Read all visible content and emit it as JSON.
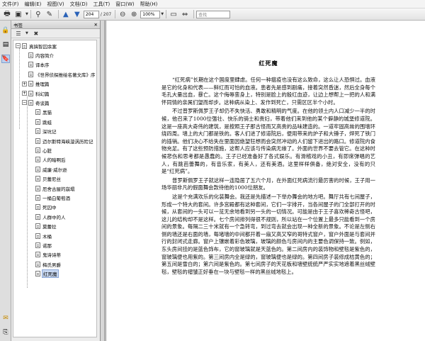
{
  "menubar": [
    "文件(F)",
    "编辑(E)",
    "视图(V)",
    "文档(D)",
    "工具(T)",
    "窗口(W)",
    "帮助(H)"
  ],
  "toolbar": {
    "page_current": "204",
    "page_total": "/ 207",
    "zoom": "100%",
    "search_placeholder": "查找"
  },
  "bookmarks_panel": {
    "title": "书签",
    "options_label": "选项",
    "items": [
      {
        "label": "真搞智囚余案",
        "level": 0,
        "expander": "minus"
      },
      {
        "label": "内容简介",
        "level": 1
      },
      {
        "label": "译本序",
        "level": 1
      },
      {
        "label": "《世界侦探推绘名著文库》序",
        "level": 1
      },
      {
        "label": "推理篇",
        "level": 1,
        "expander": "plus"
      },
      {
        "label": "科幻篇",
        "level": 1,
        "expander": "plus"
      },
      {
        "label": "奇谈篇",
        "level": 1,
        "expander": "minus"
      },
      {
        "label": "黑猫",
        "level": 2
      },
      {
        "label": "跳蛙",
        "level": 2
      },
      {
        "label": "深坑记",
        "level": 2
      },
      {
        "label": "迈尔斯特海峡漩涡历险记",
        "level": 2
      },
      {
        "label": "心脏",
        "level": 2
      },
      {
        "label": "人的暗啊后",
        "level": 2
      },
      {
        "label": "威廉·威尔逊",
        "level": 2
      },
      {
        "label": "贝蕾尼丝",
        "level": 2
      },
      {
        "label": "厄舍古屋的崩塌",
        "level": 2
      },
      {
        "label": "一桶白葡萄酒",
        "level": 2
      },
      {
        "label": "死囚中",
        "level": 2
      },
      {
        "label": "人群中的人",
        "level": 2
      },
      {
        "label": "莫蕾拉",
        "level": 2
      },
      {
        "label": "木桶",
        "level": 2
      },
      {
        "label": "诺那",
        "level": 2
      },
      {
        "label": "鬼诗诗蒂",
        "level": 2
      },
      {
        "label": "梅氏男爵",
        "level": 2
      },
      {
        "label": "红死魔",
        "level": 2,
        "selected": true
      }
    ]
  },
  "document": {
    "title": "红死魔",
    "paragraphs": [
      "“红死病”长期在这个国度里肆虐。任何一种瘟疫也没有这么致命，这么让人恐惧过。血液是它的化身和代表——鲜红而可怕的血液。患者先是感到剧痛，接着突然昏迷，然后全身每个毛孔大量出血，暴亡。这个侮辱蛮身上，特别是脸上的殷红血迹，让边上想帮上一把的人和满怀同情的亲属们望而却步。这种病从染上、发作到死亡，只需区区半个小时。",
      "不过普罗斯佩罗王子却仍不失快活、勇敢和精明的气度。在他的领土内人口减少一半的时候，他召来了1000位强壮、快乐的骑士和贵妇，带着他们来到他的某个僻静的城堡修道院。这是一座高大奇伟的建筑，是按照王子那古怪而又高贵的品味建造的。一道牢固高耸的围墙环绕四周。墙上的大门都是铁的。客人们进了修道院后，便用带来的炉子和大锤子，焊死了铁门的插销。他们决心不给失在里面因绝望狂想而会突然冲动的人们留下进出的路口。修道院内食物充足。有了这些预防措施，这帮人应该与传染病无缘了。外面的世界不要去管它。在这种时候悲伤和思考都是愚蠢的。王子已经准备好了各式娱乐。有滑稽戏的小丑，有即席弹唱的艺人，有跳芭蕾舞的，有音乐家，有美人，还有美酒。这里样样俱备，绝对安全，没有的只是“红死病”。",
      "普罗斯佩罗王子就这样一连隐居了五六个月，在外面红死病流行最厉害的时候，王子用一场华丽非凡的假面舞会款待他的1000位朋友。",
      "这是个充满欢乐的化装舞会。我还是先描述一下举办舞会的地方吧。舞厅共有七间屋子，形成一个特大的套间。许多宫殿都有这种套间，它们一字排开，当各间屋子的门全部打开的时候，从套间的一头可以一览无余地看到另一头的一切情况。可能是由于王子喜欢稀奇古怪吧，这儿的结构却不是这样。七个房间排列得很不规则，所以站在一个位置上最多只能看到一个房间的景象。每隔二三十米就有一个急转弯，到过弯去就会出现一种全新的景象。不论是左侧右侧的墙还是右面的墙，每堵墙的中间都开着一扇又高又窄的哥特式窗户，窗户外面是与套间并行的封闭式走廊。窗户上镶嵌着彩色玻璃，玻璃的颜色与房间内的主要色调保持一致。例如，东头房间挂的是蓝色饰布，它的窗玻璃就是天蓝色的。第二间房内的装饰物和壁毯是紫色的，窗玻璃便也用紫的。第三间房内全是绿的，窗玻璃便也是绿的。第四间房子装修成桔黄色的；第五间是雪白的；第六间是紫色的。第七间房子的天花板和墙壁统统严严实实地遮着黑丝绒壁毯，壁毯的褶皱正好垂在一块与壁毯一样的黑丝绒地毯上。"
    ]
  }
}
